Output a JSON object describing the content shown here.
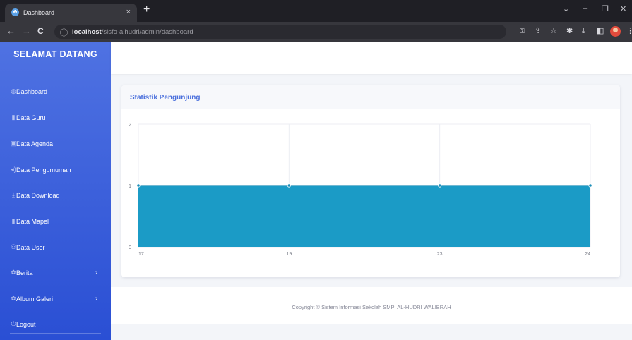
{
  "browser": {
    "tab_title": "Dashboard",
    "tab_close": "×",
    "new_tab": "+",
    "address_host": "localhost",
    "address_path": "/sisfo-alhudri/admin/dashboard",
    "back": "←",
    "forward": "→",
    "reload": "C",
    "info": "ⓘ",
    "minimize": "–",
    "maximize": "❐",
    "close_window": "✕",
    "dropdown": "⌄"
  },
  "sidebar": {
    "brand": "SELAMAT DATANG",
    "items": [
      {
        "label": "Dashboard",
        "icon": "dashboard-icon",
        "glyph": "◍"
      },
      {
        "label": "Data Guru",
        "icon": "book-icon",
        "glyph": "▮"
      },
      {
        "label": "Data Agenda",
        "icon": "calendar-icon",
        "glyph": "▣"
      },
      {
        "label": "Data Pengumuman",
        "icon": "megaphone-icon",
        "glyph": "◂)"
      },
      {
        "label": "Data Download",
        "icon": "download-icon",
        "glyph": "⤓"
      },
      {
        "label": "Data Mapel",
        "icon": "book-icon",
        "glyph": "▮"
      },
      {
        "label": "Data User",
        "icon": "users-icon",
        "glyph": "⚇"
      },
      {
        "label": "Berita",
        "icon": "gear-icon",
        "glyph": "✿",
        "chevron": "›"
      },
      {
        "label": "Album Galeri",
        "icon": "gear-icon",
        "glyph": "✿",
        "chevron": "›"
      },
      {
        "label": "Logout",
        "icon": "power-icon",
        "glyph": "⏻"
      }
    ]
  },
  "card": {
    "title": "Statistik Pengunjung"
  },
  "chart_data": {
    "type": "area",
    "categories": [
      "17",
      "19",
      "23",
      "24"
    ],
    "values": [
      1,
      1,
      1,
      1
    ],
    "ylim": [
      0,
      2
    ],
    "yticks": [
      "0",
      "1",
      "2"
    ],
    "grid": true,
    "fill_color": "#1b9bc6",
    "line_color": "#1b8db8"
  },
  "footer": {
    "copyright": "Copyright © Sistem Informasi Sekolah SMPI AL-HUDRI WALIBRAH"
  }
}
